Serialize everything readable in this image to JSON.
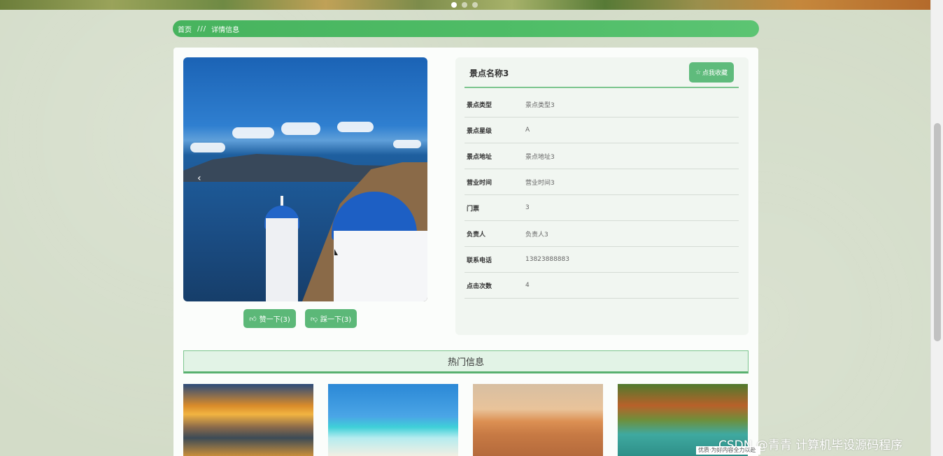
{
  "banner": {
    "slide_count": 3,
    "active_slide": 1
  },
  "breadcrumb": {
    "home": "首页",
    "separator": "///",
    "current": "详情信息"
  },
  "detail": {
    "name": "景点名称3",
    "collect_label": "点我收藏",
    "rows": [
      {
        "label": "景点类型",
        "value": "景点类型3"
      },
      {
        "label": "景点星级",
        "value": "A"
      },
      {
        "label": "景点地址",
        "value": "景点地址3"
      },
      {
        "label": "营业时间",
        "value": "营业时间3"
      },
      {
        "label": "门票",
        "value": "3"
      },
      {
        "label": "负责人",
        "value": "负责人3"
      },
      {
        "label": "联系电话",
        "value": "13823888883"
      },
      {
        "label": "点击次数",
        "value": "4"
      }
    ]
  },
  "gallery": {
    "prev_arrow": "‹"
  },
  "actions": {
    "like_label": "赞一下(3)",
    "dislike_label": "踩一下(3)"
  },
  "hot": {
    "title": "热门信息"
  },
  "watermark": {
    "main": "CSDN @青青  计算机毕设源码程序",
    "small": "优质·为好内容全力以赴"
  },
  "colors": {
    "accent": "#4fbd67",
    "button": "#5cb878",
    "background": "#d3dcc8"
  },
  "icons": {
    "like": "thumbs-up-icon",
    "dislike": "thumbs-down-icon",
    "collect": "star-icon"
  }
}
